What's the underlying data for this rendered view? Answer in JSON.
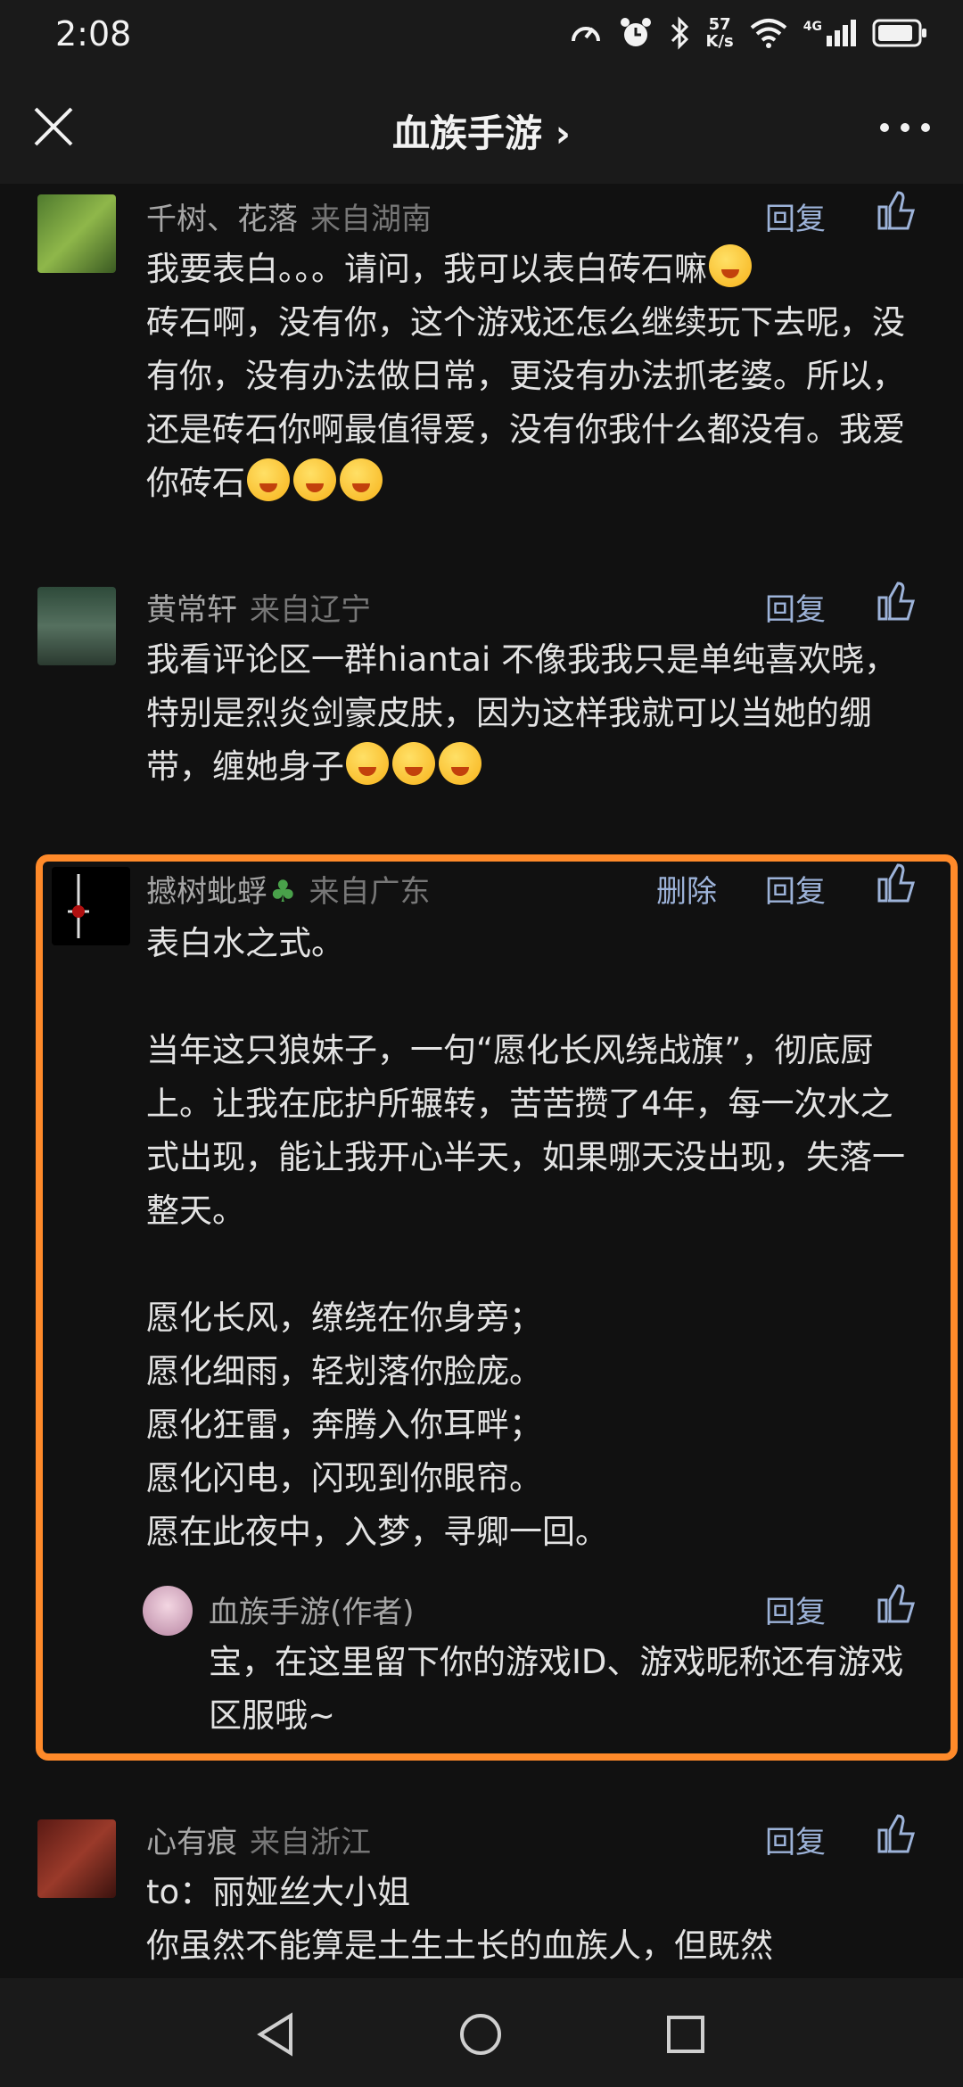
{
  "status_bar": {
    "time": "2:08",
    "net_speed_value": "57",
    "net_speed_unit": "K/s",
    "signal_type": "4G",
    "icons": [
      "speed-icon",
      "alarm-icon",
      "bluetooth-icon",
      "wifi-icon",
      "cellular-icon",
      "battery-icon"
    ]
  },
  "header": {
    "title": "血族手游 ›",
    "close_icon": "close-icon",
    "more_icon": "more-icon"
  },
  "comments": [
    {
      "user": "千树、花落",
      "location": "来自湖南",
      "reply_label": "回复",
      "text_parts": [
        "我要表白。。。请问，我可以表白砖石嘛",
        "\n砖石啊，没有你，这个游戏还怎么继续玩下去呢，没有你，没有办法做日常，更没有办法抓老婆。所以，还是砖石你啊最值得爱，没有你我什么都没有。我爱你砖石"
      ]
    },
    {
      "user": "黄常轩",
      "location": "来自辽宁",
      "reply_label": "回复",
      "text_parts": [
        "我看评论区一群hiantai 不像我我只是单纯喜欢晓，特别是烈炎剑豪皮肤，因为这样我就可以当她的绷带，缠她身子"
      ]
    },
    {
      "user": "撼树蚍蜉",
      "location": "来自广东",
      "delete_label": "删除",
      "reply_label": "回复",
      "text": "表白水之式。\n\n当年这只狼妹子，一句“愿化长风绕战旗”，彻底厨上。让我在庇护所辗转，苦苦攒了4年，每一次水之式出现，能让我开心半天，如果哪天没出现，失落一整天。\n\n愿化长风，缭绕在你身旁；\n愿化细雨，轻划落你脸庞。\n愿化狂雷，奔腾入你耳畔；\n愿化闪电，闪现到你眼帘。\n愿在此夜中，入梦，寻卿一回。",
      "reply": {
        "user": "血族手游(作者)",
        "reply_label": "回复",
        "text": "宝，在这里留下你的游戏ID、游戏昵称还有游戏区服哦~"
      }
    },
    {
      "user": "心有痕",
      "location": "来自浙江",
      "reply_label": "回复",
      "text": "to：丽娅丝大小姐\n你虽然不能算是土生土长的血族人，但既然"
    }
  ],
  "nav_bar": {
    "icons": [
      "back-icon",
      "home-icon",
      "recents-icon"
    ]
  },
  "colors": {
    "background": "#111111",
    "highlight_border": "#ff8a2a",
    "link": "#9db3d9"
  }
}
